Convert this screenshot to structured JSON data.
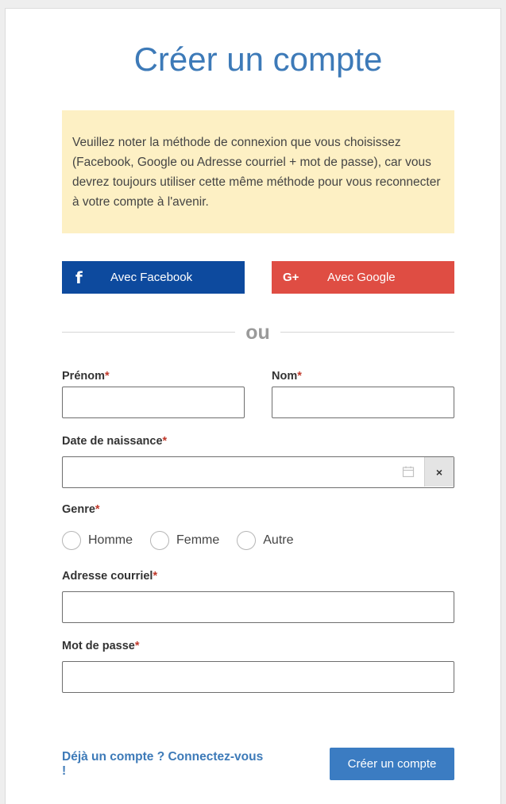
{
  "page": {
    "title": "Créer un compte",
    "notice": "Veuillez noter la méthode de connexion que vous choisissez (Facebook, Google ou Adresse courriel + mot de passe), car vous devrez toujours utiliser cette même méthode pour vous reconnecter à votre compte à l'avenir."
  },
  "social": {
    "facebook": {
      "icon_glyph": "f",
      "icon": "facebook-icon",
      "label": "Avec Facebook",
      "color": "#0d4a9e"
    },
    "google": {
      "icon_glyph": "G+",
      "icon": "google-plus-icon",
      "label": "Avec Google",
      "color": "#df4d43"
    }
  },
  "divider": {
    "text": "ou"
  },
  "form": {
    "required_marker": "*",
    "first_name": {
      "label": "Prénom",
      "value": "",
      "placeholder": ""
    },
    "last_name": {
      "label": "Nom",
      "value": "",
      "placeholder": ""
    },
    "birth_date": {
      "label": "Date de naissance",
      "value": "",
      "calendar_icon": "calendar-icon",
      "clear_glyph": "×"
    },
    "gender": {
      "label": "Genre",
      "options": [
        "Homme",
        "Femme",
        "Autre"
      ],
      "selected": null
    },
    "email": {
      "label": "Adresse courriel",
      "value": "",
      "placeholder": ""
    },
    "password": {
      "label": "Mot de passe",
      "value": "",
      "placeholder": ""
    }
  },
  "footer": {
    "login_link": "Déjà un compte ? Connectez-vous !",
    "submit_label": "Créer un compte"
  },
  "colors": {
    "accent": "#3d7ab8",
    "submit": "#3b7cc2",
    "notice_bg": "#fdf0c4",
    "required": "#c0392b"
  }
}
